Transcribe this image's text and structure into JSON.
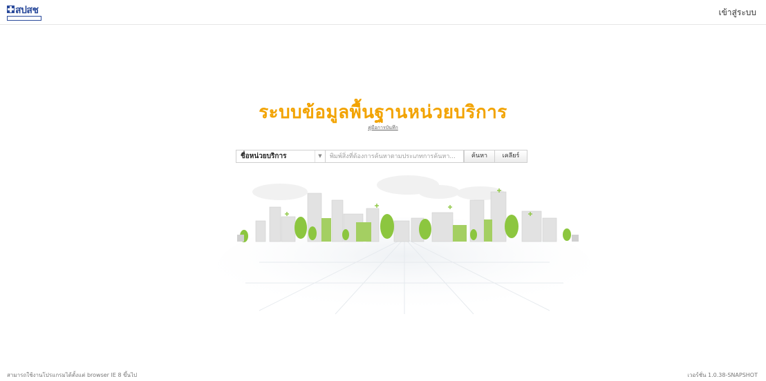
{
  "header": {
    "logo_text": "สปสช",
    "login_label": "เข้าสู่ระบบ"
  },
  "main": {
    "title": "ระบบข้อมูลพื้นฐานหน่วยบริการ",
    "manual_link": "คู่มือการบันทึก"
  },
  "search": {
    "type_selected": "ชื่อหน่วยบริการ",
    "placeholder": "พิมพ์สิ่งที่ต้องการค้นหาตามประเภทการค้นหา...",
    "search_button": "ค้นหา",
    "clear_button": "เคลียร์"
  },
  "footer": {
    "browser_note": "สามารถใช้งานโปรแกรมได้ตั้งแต่ browser IE 8 ขึ้นไป",
    "version": "เวอร์ชั่น 1.0.38-SNAPSHOT"
  },
  "colors": {
    "title": "#f2a300",
    "brand": "#2a4a9b",
    "tree_green": "#8cc63f",
    "building_gray": "#d7d7d7"
  },
  "icons": {
    "caret": "chevron-down-icon",
    "logo": "nhso-logo-icon"
  }
}
